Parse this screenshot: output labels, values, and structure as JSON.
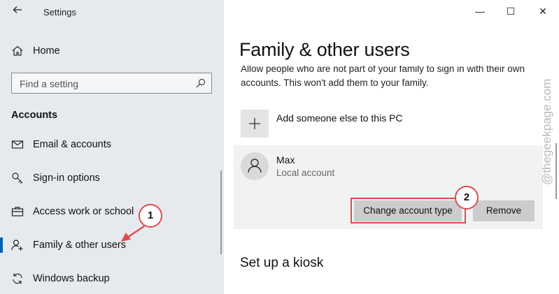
{
  "window": {
    "title": "Settings",
    "controls": {
      "minimize": "—",
      "maximize": "☐",
      "close": "✕"
    }
  },
  "sidebar": {
    "home_label": "Home",
    "search": {
      "placeholder": "Find a setting"
    },
    "section_title": "Accounts",
    "items": [
      {
        "label": "Email & accounts",
        "icon": "mail-icon"
      },
      {
        "label": "Sign-in options",
        "icon": "key-icon"
      },
      {
        "label": "Access work or school",
        "icon": "briefcase-icon"
      },
      {
        "label": "Family & other users",
        "icon": "person-add-icon",
        "selected": true
      },
      {
        "label": "Windows backup",
        "icon": "sync-icon"
      }
    ]
  },
  "main": {
    "title": "Family & other users",
    "description": "Allow people who are not part of your family to sign in with their own accounts. This won't add them to your family.",
    "add_label": "Add someone else to this PC",
    "user": {
      "name": "Max",
      "type": "Local account",
      "change_label": "Change account type",
      "remove_label": "Remove"
    },
    "kiosk_title": "Set up a kiosk"
  },
  "annotations": {
    "step1": "1",
    "step2": "2",
    "color": "#e04a4a"
  },
  "watermark": "@thegeekpage.com",
  "colors": {
    "sidebar_bg": "#e6eaee",
    "accent": "#0063b1",
    "button_bg": "#cccccc"
  }
}
